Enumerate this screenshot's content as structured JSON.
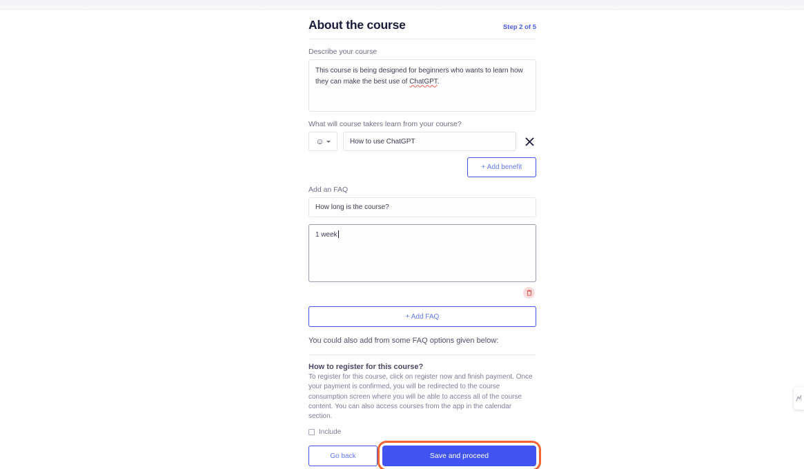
{
  "header": {
    "title": "About the course",
    "step": "Step 2 of 5"
  },
  "describe": {
    "label": "Describe your course",
    "value_part1": "This course is being designed for beginners who wants to learn how they can make the best use of ",
    "value_misspelled": "ChatGPT",
    "value_part2": "."
  },
  "benefits": {
    "label": "What will course takers learn from your course?",
    "emoji_icon": "smiley-face-icon",
    "emoji_glyph": "☺",
    "items": [
      {
        "value": "How to use ChatGPT"
      }
    ],
    "remove_icon": "close-x-icon",
    "add_label": "+ Add benefit"
  },
  "faq": {
    "label": "Add an FAQ",
    "question_value": "How long is the course?",
    "answer_value": "1 week",
    "delete_icon": "trash-icon",
    "add_label": "+ Add FAQ",
    "note": "You could also add from some FAQ options given below:"
  },
  "faq_options": [
    {
      "title": "How to register for this course?",
      "body": "To register for this course, click on register now and finish payment. Once your payment is confirmed, you will be redirected to the course consumption screen where you will be able to access all of the course content. You can also access courses from the app in the calendar section.",
      "include_label": "Include",
      "include_checked": false
    }
  ],
  "footer": {
    "back_label": "Go back",
    "save_label": "Save and proceed"
  },
  "edge_widget": {
    "icon": "analytics-chart-icon"
  },
  "colors": {
    "accent_blue": "#4154f1",
    "link_blue": "#6478f5",
    "step_blue": "#4a5bf0",
    "highlight_orange": "#f4622e",
    "danger_red": "#e05a5a",
    "text_dark": "#1b1b3a",
    "text_muted": "#7e7e99"
  }
}
